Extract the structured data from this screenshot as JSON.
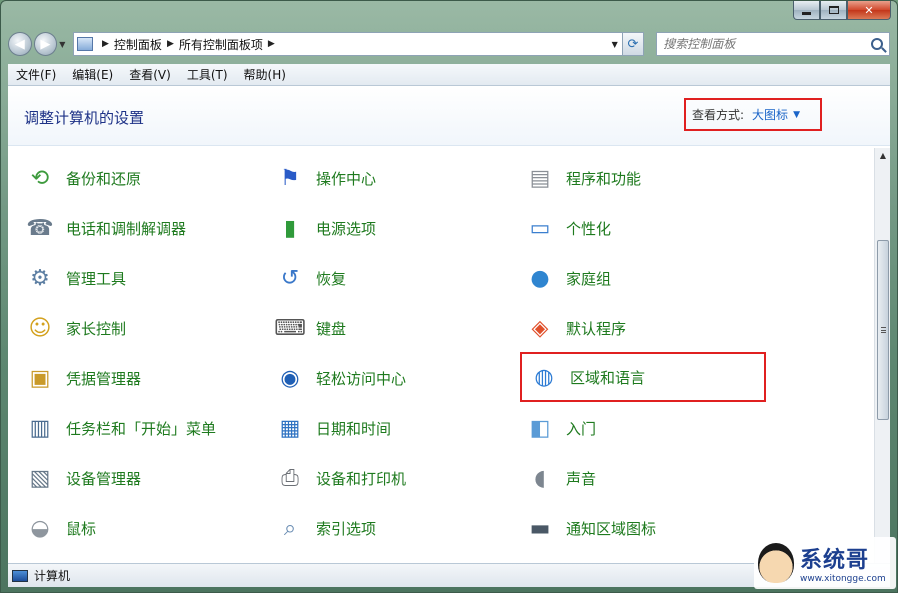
{
  "address_bar": {
    "crumbs": [
      "控制面板",
      "所有控制面板项"
    ],
    "search_placeholder": "搜索控制面板"
  },
  "menubar": [
    "文件(F)",
    "编辑(E)",
    "查看(V)",
    "工具(T)",
    "帮助(H)"
  ],
  "header": {
    "title": "调整计算机的设置",
    "view_by_label": "查看方式:",
    "view_by_value": "大图标"
  },
  "items": [
    {
      "label": "备份和还原",
      "icon": "backup-restore-icon",
      "color": "#3d9a3d"
    },
    {
      "label": "操作中心",
      "icon": "action-center-flag-icon",
      "color": "#2a5bc7"
    },
    {
      "label": "程序和功能",
      "icon": "programs-features-icon",
      "color": "#8a8f96"
    },
    {
      "label": "电话和调制解调器",
      "icon": "phone-modem-icon",
      "color": "#6a7b8c"
    },
    {
      "label": "电源选项",
      "icon": "power-options-battery-icon",
      "color": "#2f9a3a"
    },
    {
      "label": "个性化",
      "icon": "personalization-monitor-icon",
      "color": "#3b7fcf"
    },
    {
      "label": "管理工具",
      "icon": "admin-tools-icon",
      "color": "#5d7fa3"
    },
    {
      "label": "恢复",
      "icon": "recovery-icon",
      "color": "#3a78c9"
    },
    {
      "label": "家庭组",
      "icon": "homegroup-icon",
      "color": "#2f85d0"
    },
    {
      "label": "家长控制",
      "icon": "parental-controls-icon",
      "color": "#d3a11e"
    },
    {
      "label": "键盘",
      "icon": "keyboard-icon",
      "color": "#555555"
    },
    {
      "label": "默认程序",
      "icon": "default-programs-icon",
      "color": "#e04f2a"
    },
    {
      "label": "凭据管理器",
      "icon": "credential-manager-icon",
      "color": "#c99a2a"
    },
    {
      "label": "轻松访问中心",
      "icon": "ease-of-access-icon",
      "color": "#1f5fb5"
    },
    {
      "label": "区域和语言",
      "icon": "region-language-globe-icon",
      "color": "#2c7bd4"
    },
    {
      "label": "任务栏和「开始」菜单",
      "icon": "taskbar-start-menu-icon",
      "color": "#4a6b8f"
    },
    {
      "label": "日期和时间",
      "icon": "date-time-icon",
      "color": "#2e72c2"
    },
    {
      "label": "入门",
      "icon": "getting-started-icon",
      "color": "#5a9bd6"
    },
    {
      "label": "设备管理器",
      "icon": "device-manager-icon",
      "color": "#667788"
    },
    {
      "label": "设备和打印机",
      "icon": "devices-printers-icon",
      "color": "#6b6f75"
    },
    {
      "label": "声音",
      "icon": "sound-speaker-icon",
      "color": "#7d8690"
    },
    {
      "label": "鼠标",
      "icon": "mouse-icon",
      "color": "#8e969e"
    },
    {
      "label": "索引选项",
      "icon": "indexing-options-icon",
      "color": "#6a8db3"
    },
    {
      "label": "通知区域图标",
      "icon": "notification-area-icon",
      "color": "#4a5866"
    }
  ],
  "statusbar": {
    "text": "计算机"
  },
  "watermark": {
    "brand": "系统哥",
    "url": "www.xitongge.com"
  }
}
